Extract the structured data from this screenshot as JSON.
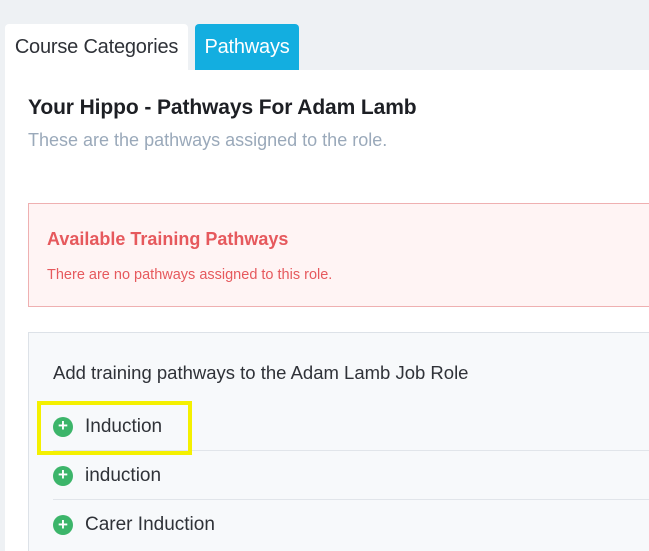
{
  "tabs": [
    {
      "label": "Course Categories",
      "active": false
    },
    {
      "label": "Pathways",
      "active": true
    }
  ],
  "header": {
    "title": "Your Hippo - Pathways For Adam Lamb",
    "subtitle": "These are the pathways assigned to the role."
  },
  "alert": {
    "title": "Available Training Pathways",
    "message": "There are no pathways assigned to this role."
  },
  "add_section": {
    "heading": "Add training pathways to the Adam Lamb Job Role",
    "items": [
      {
        "label": "Induction",
        "icon": "plus-circle-icon",
        "highlighted": true
      },
      {
        "label": "induction",
        "icon": "plus-circle-icon",
        "highlighted": false
      },
      {
        "label": "Carer Induction",
        "icon": "plus-circle-icon",
        "highlighted": false
      }
    ]
  },
  "colors": {
    "accent": "#13aee0",
    "alert_text": "#e6595d",
    "alert_bg": "#fff4f4",
    "add_icon": "#3cb56a",
    "highlight": "#f4f000"
  }
}
